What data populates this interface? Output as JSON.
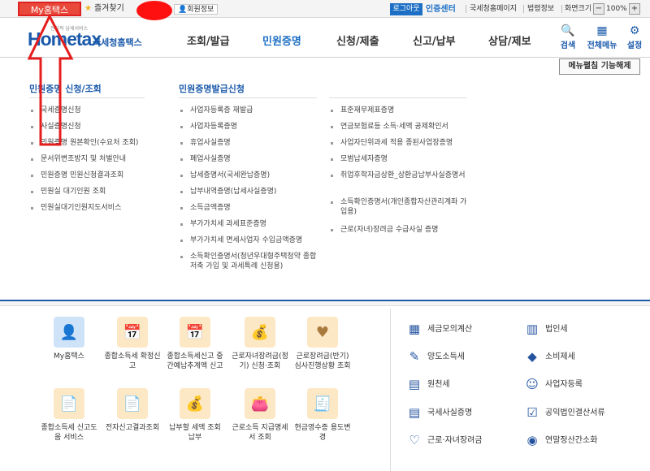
{
  "topbar": {
    "my_hometax": "My홈택스",
    "favorites": "즐겨찾기",
    "user_info": "회원정보",
    "logout": "로그아웃",
    "cert_center": "인증센터",
    "nts_home": "국세청홈페이지",
    "law_info": "법령정보",
    "screen_size": "화면크기",
    "zoom_out": "−",
    "zoom_in": "+",
    "zoom_value": "100%"
  },
  "header": {
    "logo_text": "Hometax",
    "logo_sub": "국세청홈택스",
    "logo_tiny": "전자적 납세서비스",
    "nav": [
      "조회/발급",
      "민원증명",
      "신청/제출",
      "신고/납부",
      "상담/제보"
    ],
    "active_nav": "민원증명",
    "search": "검색",
    "all_menu": "전체메뉴",
    "settings": "설정"
  },
  "menu_fix_button": "메뉴펼침 기능해제",
  "columns": {
    "col1_title": "민원증명 신청/조회",
    "col2_title": "민원증명발급신청",
    "col1": [
      "국세증명신청",
      "사실증명신청",
      "민원증명 원본확인(수요처 조회)",
      "문서위변조방지 및 처벌안내",
      "민원증명 민원신청결과조회",
      "민원실 대기인원 조회",
      "민원실대기인원지도서비스"
    ],
    "col2": [
      "사업자등록증 재발급",
      "사업자등록증명",
      "휴업사실증명",
      "폐업사실증명",
      "납세증명서(국세완납증명)",
      "납부내역증명(납세사실증명)",
      "소득금액증명",
      "부가가치세 과세표준증명",
      "부가가치세 면세사업자 수입금액증명",
      "소득확인증명서(청년우대형주택청약 종합저축 가입 및 과세특례 신청용)"
    ],
    "col3": [
      "표준재무제표증명",
      "연금보험료등 소득·세액 공제확인서",
      "사업자단위과세 적용 종된사업장증명",
      "모범납세자증명",
      "취업후학자금상환_상환금납부사실증명서",
      "소득확인증명서(개인종합자산관리계좌 가입용)",
      "근로(자녀)장려금 수급사실 증명"
    ]
  },
  "quick_tiles": [
    {
      "label": "My홈택스",
      "icon": "person-icon"
    },
    {
      "label": "종합소득세 확정신고",
      "icon": "calendar-icon"
    },
    {
      "label": "종합소득세신고 중간예납추계액 신고",
      "icon": "calendar-icon"
    },
    {
      "label": "근로자녀장려금(정기) 신청·조회",
      "icon": "coin-bag-icon"
    },
    {
      "label": "근로장려금(반기) 심사진행상황 조회",
      "icon": "heart-hand-icon"
    },
    {
      "label": "종합소득세 신고도움 서비스",
      "icon": "document-icon"
    },
    {
      "label": "전자신고결과조회",
      "icon": "document-icon"
    },
    {
      "label": "납부할 세액 조회납부",
      "icon": "coin-bag-icon"
    },
    {
      "label": "근로소득 지급명세서 조회",
      "icon": "wallet-icon"
    },
    {
      "label": "현금영수증 용도변경",
      "icon": "receipt-icon"
    }
  ],
  "right_links": [
    {
      "label": "세금모의계산",
      "icon": "calculator-icon"
    },
    {
      "label": "법인세",
      "icon": "building-icon"
    },
    {
      "label": "양도소득세",
      "icon": "document-pen-icon"
    },
    {
      "label": "소비제세",
      "icon": "diamond-icon"
    },
    {
      "label": "원천세",
      "icon": "file-icon"
    },
    {
      "label": "사업자등록",
      "icon": "person-icon"
    },
    {
      "label": "국세사실증명",
      "icon": "document-icon"
    },
    {
      "label": "공익법인결산서류",
      "icon": "clipboard-icon"
    },
    {
      "label": "근로·자녀장려금",
      "icon": "heart-icon"
    },
    {
      "label": "연말정산간소화",
      "icon": "hand-coin-icon"
    }
  ]
}
